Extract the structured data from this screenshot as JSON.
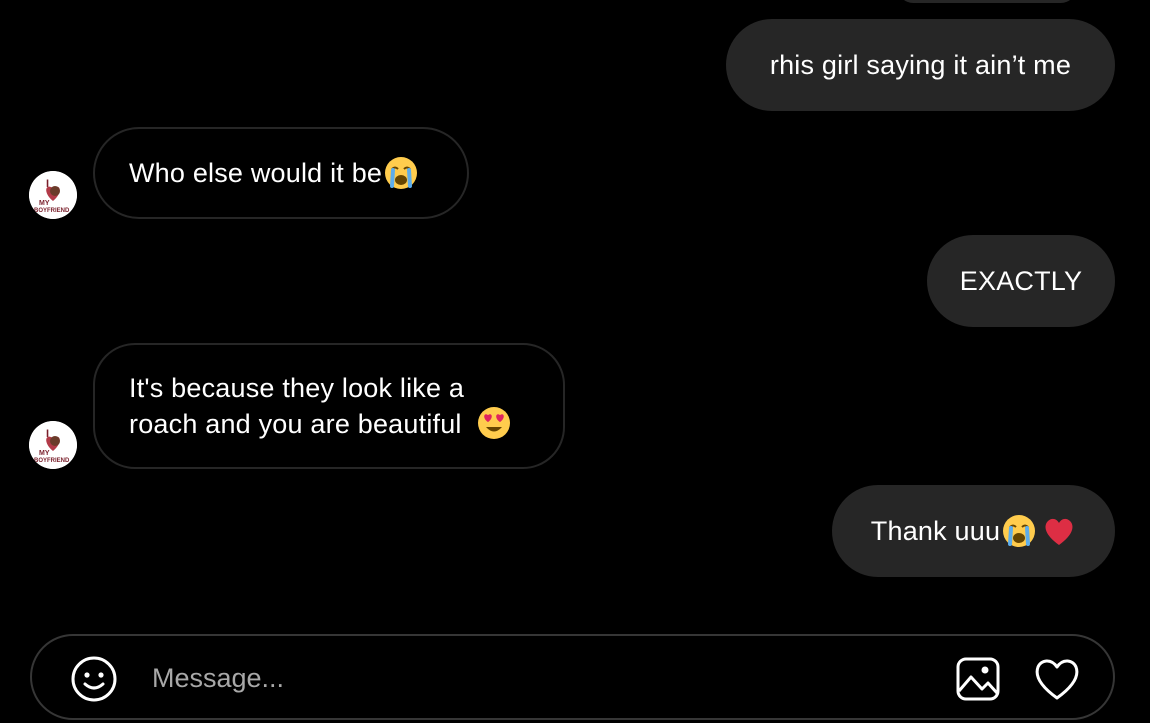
{
  "messages": [
    {
      "direction": "outgoing",
      "text": "rhis girl saying it ain’t me",
      "emojis": []
    },
    {
      "direction": "incoming",
      "text": "Who else would it be",
      "emojis": [
        "loudly-crying-face"
      ]
    },
    {
      "direction": "outgoing",
      "text": "EXACTLY",
      "emojis": []
    },
    {
      "direction": "incoming",
      "lines": [
        "It's because they look like a",
        "roach and you are beautiful "
      ],
      "emojis": [
        "heart-eyes-face"
      ]
    },
    {
      "direction": "outgoing",
      "text": "Thank uuu",
      "emojis": [
        "loudly-crying-face",
        "red-heart"
      ]
    }
  ],
  "avatar": {
    "label_top": "I",
    "label_mid": "MY",
    "label_bottom": "BOYFRIEND",
    "colors": {
      "text": "#7a1f2b",
      "heart": "#b23a48"
    }
  },
  "composer": {
    "placeholder": "Message...",
    "value": "",
    "icons": [
      "smiley-face-icon",
      "image-gallery-icon",
      "heart-outline-icon"
    ]
  },
  "colors": {
    "background": "#000000",
    "outgoing_bubble": "#262626",
    "incoming_border": "#262626",
    "text": "#ffffff",
    "placeholder": "#a8a8a8"
  }
}
